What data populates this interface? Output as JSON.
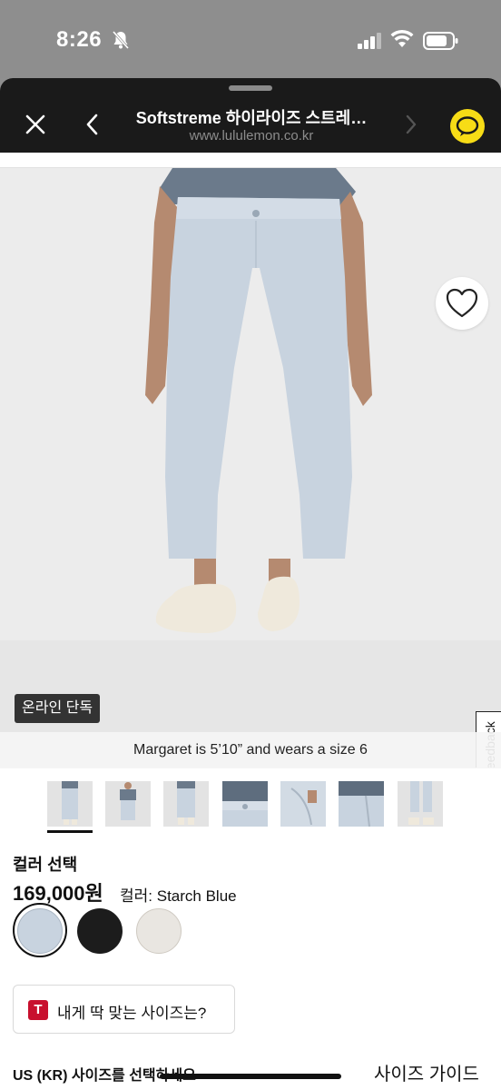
{
  "status_bar": {
    "time": "8:26"
  },
  "header": {
    "title": "Softstreme 하이라이즈 스트레…",
    "url": "www.lululemon.co.kr"
  },
  "product": {
    "badge": "온라인 단독",
    "model_caption": "Margaret is 5’10” and wears a size 6",
    "feedback_label": "Feedback"
  },
  "color_section": {
    "title": "컬러 선택",
    "price": "169,000원",
    "color_prefix": "컬러: ",
    "color_name": "Starch Blue",
    "swatches": [
      {
        "name": "Starch Blue",
        "hex": "#c8d3df",
        "selected": true
      },
      {
        "name": "Black",
        "hex": "#1c1c1c",
        "selected": false
      },
      {
        "name": "Light",
        "hex": "#e9e6e1",
        "selected": false
      }
    ]
  },
  "fit": {
    "icon_letter": "T",
    "label": "내게 딱 맞는 사이즈는?"
  },
  "size": {
    "select_label": "US (KR) 사이즈를 선택하세요",
    "guide_label": "사이즈 가이드"
  },
  "colors": {
    "header_bg": "#1a1a1a",
    "kakao": "#f7dc16",
    "fit_red": "#c8102e",
    "pants": "#c8d3df"
  }
}
